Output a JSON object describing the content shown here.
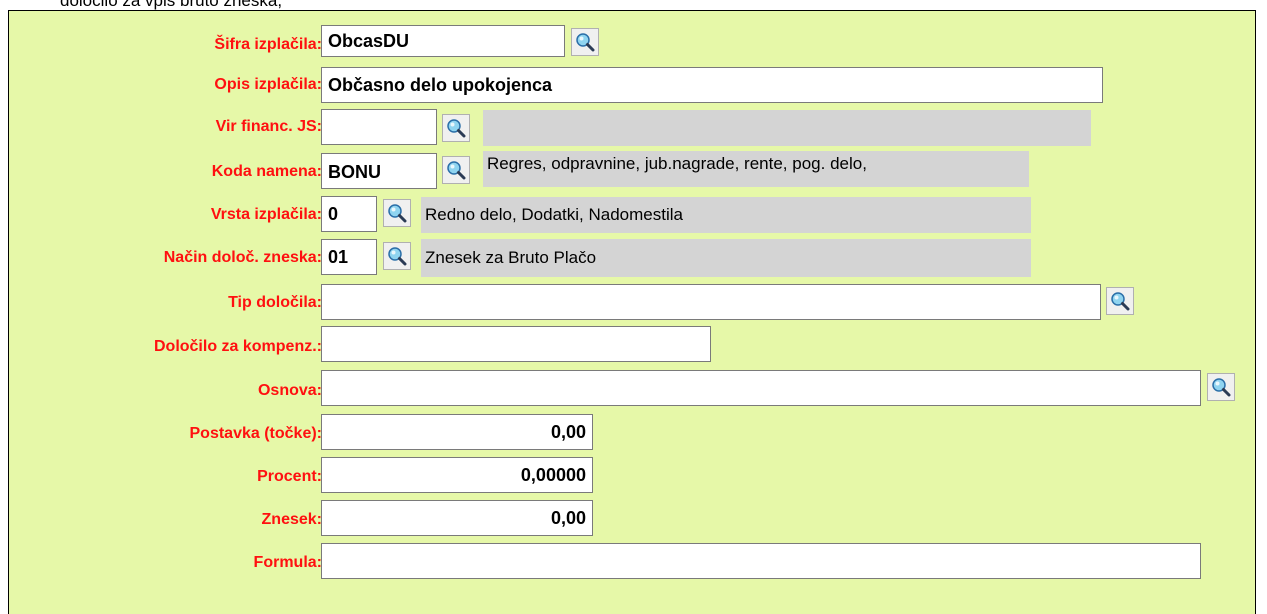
{
  "intro_text": "določilo za vpis bruto zneska,",
  "form": {
    "sifra": {
      "label": "Šifra izplačila:",
      "value": "ObcasDU"
    },
    "opis": {
      "label": "Opis izplačila:",
      "value": "Občasno delo upokojenca"
    },
    "vir": {
      "label": "Vir financ. JS:",
      "value": "",
      "description": ""
    },
    "koda": {
      "label": "Koda namena:",
      "value": "BONU",
      "description": "Regres, odpravnine, jub.nagrade, rente, pog. delo,"
    },
    "vrsta": {
      "label": "Vrsta izplačila:",
      "value": "0",
      "description": "Redno delo, Dodatki, Nadomestila"
    },
    "nacin": {
      "label": "Način določ. zneska:",
      "value": "01",
      "description": "Znesek za Bruto Plačo"
    },
    "tip": {
      "label": "Tip določila:",
      "value": ""
    },
    "dolocilo": {
      "label": "Določilo za kompenz.:",
      "value": ""
    },
    "osnova": {
      "label": "Osnova:",
      "value": ""
    },
    "postavka": {
      "label": "Postavka (točke):",
      "value": "0,00"
    },
    "procent": {
      "label": "Procent:",
      "value": "0,00000"
    },
    "znesek": {
      "label": "Znesek:",
      "value": "0,00"
    },
    "formula": {
      "label": "Formula:",
      "value": ""
    }
  },
  "icons": {
    "lookup": "magnifier-icon"
  }
}
